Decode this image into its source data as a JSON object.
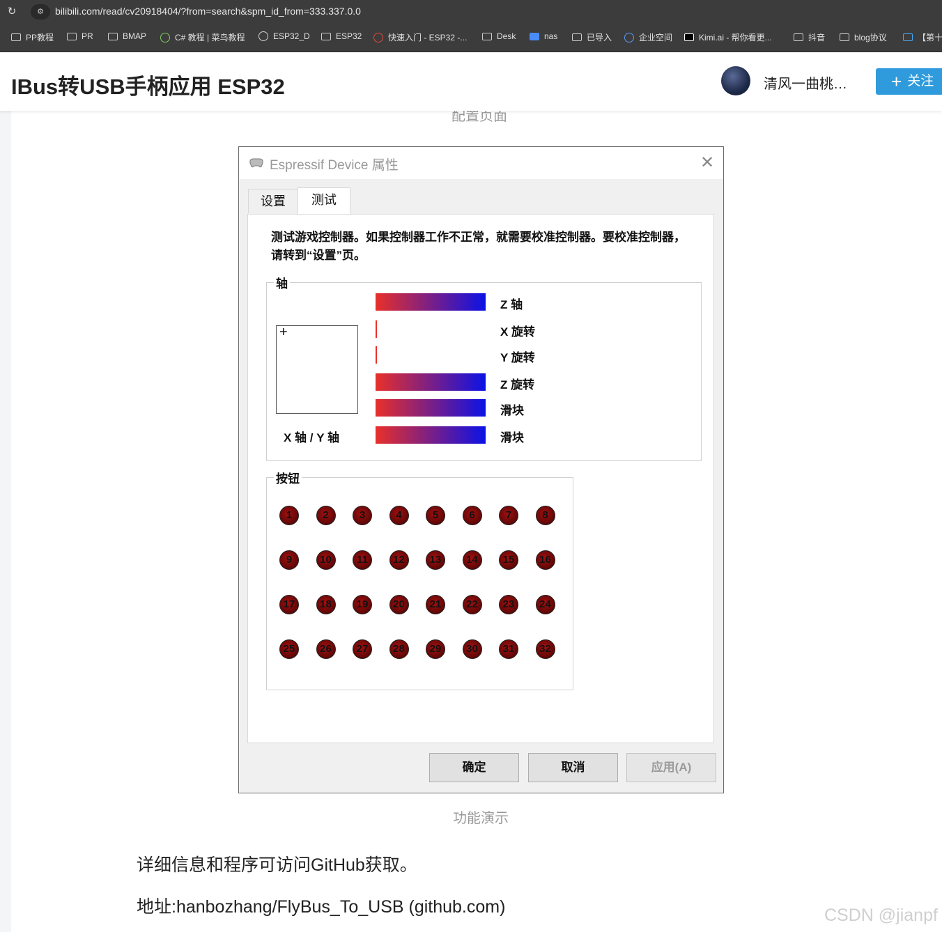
{
  "browser": {
    "url": "bilibili.com/read/cv20918404/?from=search&spm_id_from=333.337.0.0",
    "bookmarks": [
      {
        "label": "PP教程",
        "icon": "folder-icon"
      },
      {
        "label": "PR",
        "icon": "folder-icon"
      },
      {
        "label": "BMAP",
        "icon": "folder-icon"
      },
      {
        "label": "C# 教程 | 菜鸟教程",
        "icon": "runoob-icon"
      },
      {
        "label": "ESP32_D",
        "icon": "globe-icon"
      },
      {
        "label": "ESP32",
        "icon": "folder-icon"
      },
      {
        "label": "快速入门 - ESP32 -...",
        "icon": "espressif-icon"
      },
      {
        "label": "Desk",
        "icon": "folder-icon"
      },
      {
        "label": "nas",
        "icon": "dsm-icon"
      },
      {
        "label": "已导入",
        "icon": "folder-icon"
      },
      {
        "label": "企业空间",
        "icon": "cloud-icon"
      },
      {
        "label": "Kimi.ai - 帮你看更...",
        "icon": "kimi-icon"
      },
      {
        "label": "抖音",
        "icon": "folder-icon"
      },
      {
        "label": "blog协议",
        "icon": "folder-icon"
      },
      {
        "label": "【第十",
        "icon": "bilibili-tv-icon"
      }
    ]
  },
  "article": {
    "title": "IBus转USB手柄应用 ESP32",
    "author": "清风一曲桃…",
    "follow_label": "关注",
    "top_caption": "配置页面",
    "image_caption": "功能演示",
    "para1": "详细信息和程序可访问GitHub获取。",
    "para2": "地址:hanbozhang/FlyBus_To_USB (github.com)",
    "watermark": "CSDN @jianpf"
  },
  "dialog": {
    "title": "Espressif Device 属性",
    "tabs": [
      "设置",
      "测试"
    ],
    "active_tab": "测试",
    "description": "测试游戏控制器。如果控制器工作不正常，就需要校准控制器。要校准控制器，请转到“设置”页。",
    "axes_group": "轴",
    "xy_label": "X 轴 / Y 轴",
    "axes": [
      {
        "label": "Z 轴",
        "level": 1.0
      },
      {
        "label": "X 旋转",
        "level": 0.0
      },
      {
        "label": "Y 旋转",
        "level": 0.0
      },
      {
        "label": "Z 旋转",
        "level": 1.0
      },
      {
        "label": "滑块",
        "level": 1.0
      },
      {
        "label": "滑块",
        "level": 1.0
      }
    ],
    "buttons_group": "按钮",
    "buttons": [
      "1",
      "2",
      "3",
      "4",
      "5",
      "6",
      "7",
      "8",
      "9",
      "10",
      "11",
      "12",
      "13",
      "14",
      "15",
      "16",
      "17",
      "18",
      "19",
      "20",
      "21",
      "22",
      "23",
      "24",
      "25",
      "26",
      "27",
      "28",
      "29",
      "30",
      "31",
      "32"
    ],
    "ok_label": "确定",
    "cancel_label": "取消",
    "apply_label": "应用(A)"
  }
}
